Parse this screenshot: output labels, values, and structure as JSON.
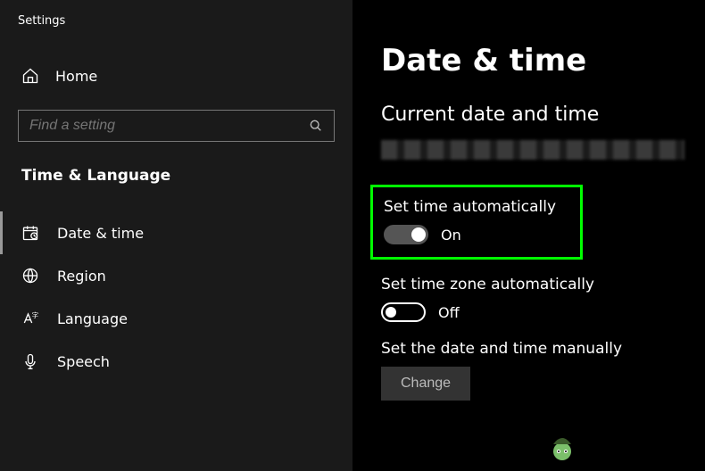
{
  "window": {
    "title": "Settings"
  },
  "sidebar": {
    "home_label": "Home",
    "search_placeholder": "Find a setting",
    "category": "Time & Language",
    "items": [
      {
        "label": "Date & time",
        "icon": "date-time-icon",
        "selected": true
      },
      {
        "label": "Region",
        "icon": "region-icon",
        "selected": false
      },
      {
        "label": "Language",
        "icon": "language-icon",
        "selected": false
      },
      {
        "label": "Speech",
        "icon": "speech-icon",
        "selected": false
      }
    ]
  },
  "main": {
    "title": "Date & time",
    "section_current": "Current date and time",
    "set_time_auto": {
      "label": "Set time automatically",
      "state": "On",
      "on": true
    },
    "set_tz_auto": {
      "label": "Set time zone automatically",
      "state": "Off",
      "on": false
    },
    "manual": {
      "label": "Set the date and time manually",
      "button": "Change"
    }
  }
}
